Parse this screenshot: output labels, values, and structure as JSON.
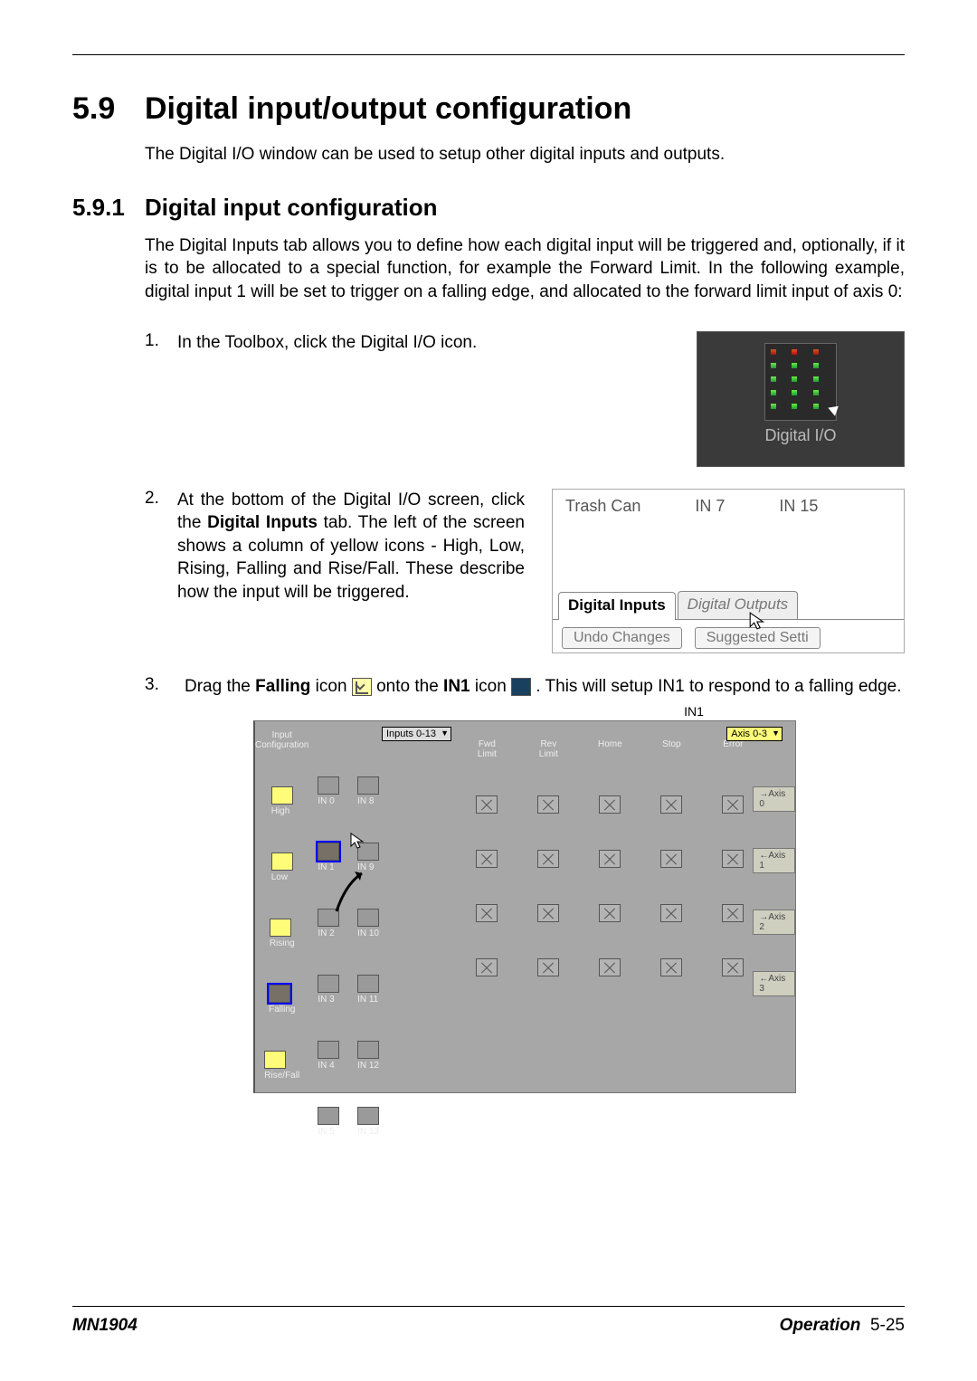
{
  "section": {
    "number": "5.9",
    "title": "Digital input/output configuration",
    "intro": "The Digital I/O window can be used to setup other digital inputs and outputs."
  },
  "subsection": {
    "number": "5.9.1",
    "title": "Digital input configuration",
    "intro": "The Digital Inputs tab allows you to define how each digital input will be triggered and, optionally, if it is to be allocated to a special function, for example the Forward Limit. In the following example, digital input 1 will be set to trigger on a falling edge, and allocated to the forward limit input of axis 0:"
  },
  "steps": {
    "s1_num": "1.",
    "s1_text": "In the Toolbox, click the Digital I/O icon.",
    "s2_num": "2.",
    "s2_text_lead": "At the bottom of the Digital I/O screen, click the ",
    "s2_text_bold": "Digital Inputs",
    "s2_text_tail": " tab. The left of the screen shows a column of yellow icons - High, Low, Rising, Falling and Rise/Fall. These describe how the input will be triggered.",
    "s3_num": "3.",
    "s3_a": "Drag the ",
    "s3_b": "Falling",
    "s3_c": " icon ",
    "s3_d": " onto the ",
    "s3_e": "IN1",
    "s3_f": " icon ",
    "s3_g": " .  This will setup IN1 to respond to a falling edge.",
    "in1_caption": "IN1"
  },
  "fig1": {
    "label": "Digital I/O"
  },
  "fig2": {
    "col_trash": "Trash Can",
    "col_in7": "IN 7",
    "col_in15": "IN 15",
    "tab_inputs": "Digital Inputs",
    "tab_outputs": "Digital Outputs",
    "btn_undo": "Undo Changes",
    "btn_suggest": "Suggested Setti"
  },
  "fig3": {
    "hdr_types": "Input\nConfiguration",
    "dropdown": "Inputs 0-13",
    "axis_dropdown": "Axis 0-3",
    "type_labels": [
      "High",
      "Low",
      "Rising",
      "Falling",
      "Rise/Fall"
    ],
    "input_cols_a": [
      "IN 0",
      "IN 1",
      "IN 2",
      "IN 3",
      "IN 4",
      "IN 5"
    ],
    "input_cols_b": [
      "IN 8",
      "IN 9",
      "IN 10",
      "IN 11",
      "IN 12",
      "IN 13"
    ],
    "func_headers": [
      "Fwd\nLimit",
      "Rev\nLimit",
      "Home",
      "Stop",
      "Error"
    ],
    "axis_headers": "",
    "axis_buttons": [
      "→Axis 0",
      "←Axis 1",
      "→Axis 2",
      "←Axis 3"
    ]
  },
  "footer": {
    "doc": "MN1904",
    "section": "Operation",
    "page": "5-25"
  }
}
